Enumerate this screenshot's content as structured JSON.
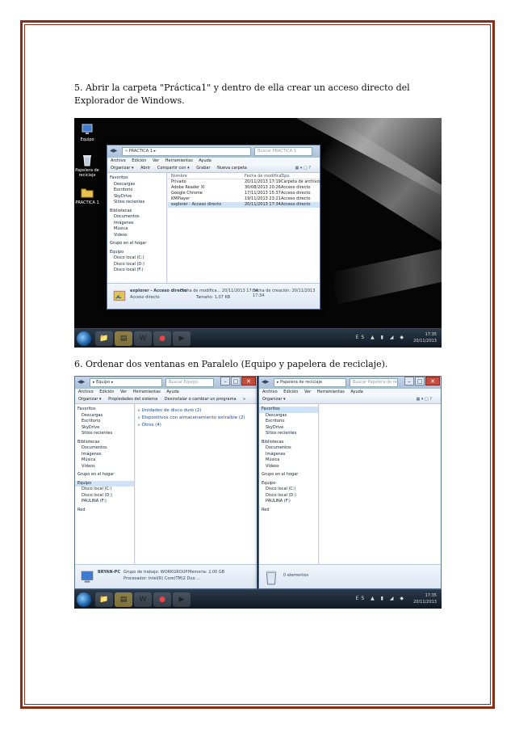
{
  "instructions": {
    "step5": "5. Abrir la carpeta \"Práctica1\" y dentro de ella crear un acceso directo del Explorador de Windows.",
    "step6": "6. Ordenar dos ventanas en Paralelo (Equipo y papelera de reciclaje)."
  },
  "shot1": {
    "desktop_icons": [
      {
        "label": "Equipo",
        "icon": "computer-icon"
      },
      {
        "label": "Papelera de reciclaje",
        "icon": "recycle-bin-icon"
      },
      {
        "label": "PRACTICA 1",
        "icon": "folder-icon"
      }
    ],
    "window": {
      "address": "« PRACTICA 1 ▸",
      "search_placeholder": "Buscar PRACTICA 1",
      "menu": [
        "Archivo",
        "Edición",
        "Ver",
        "Herramientas",
        "Ayuda"
      ],
      "toolbar": [
        "Organizar ▾",
        "Abrir",
        "Compartir con ▾",
        "Grabar",
        "Nueva carpeta"
      ],
      "nav": [
        {
          "label": "Favoritos",
          "header": true
        },
        {
          "label": "Descargas"
        },
        {
          "label": "Escritorio"
        },
        {
          "label": "SkyDrive"
        },
        {
          "label": "Sitios recientes"
        },
        {
          "label": "Bibliotecas",
          "header": true
        },
        {
          "label": "Documentos"
        },
        {
          "label": "Imágenes"
        },
        {
          "label": "Música"
        },
        {
          "label": "Videos"
        },
        {
          "label": "Grupo en el hogar",
          "header": true
        },
        {
          "label": "Equipo",
          "header": true
        },
        {
          "label": "Disco local (C:)"
        },
        {
          "label": "Disco local (D:)"
        },
        {
          "label": "Disco local (F:)"
        }
      ],
      "columns": [
        "Nombre",
        "Fecha de modifica...",
        "Tipo"
      ],
      "files": [
        {
          "name": "Privado",
          "date": "20/11/2013 17:19",
          "type": "Carpeta de archivos"
        },
        {
          "name": "Adobe Reader XI",
          "date": "30/08/2013 20:26",
          "type": "Acceso directo"
        },
        {
          "name": "Google Chrome",
          "date": "17/11/2013 15:37",
          "type": "Acceso directo"
        },
        {
          "name": "KMPlayer",
          "date": "19/11/2013 23:21",
          "type": "Acceso directo"
        },
        {
          "name": "explorer - Acceso directo",
          "date": "20/11/2013 17:34",
          "type": "Acceso directo",
          "selected": true
        }
      ],
      "details": {
        "name": "explorer - Acceso directo",
        "kind": "Acceso directo",
        "modified": "Fecha de modifica... 20/11/2013 17:34",
        "size": "Tamaño: 1,07 KB",
        "created": "Fecha de creación: 20/11/2013 17:34"
      }
    },
    "taskbar": {
      "lang": "ES",
      "time": "17:35",
      "date": "20/11/2013"
    }
  },
  "shot2": {
    "left_window": {
      "address": "▸ Equipo ▸",
      "search_placeholder": "Buscar Equipo",
      "menu": [
        "Archivo",
        "Edición",
        "Ver",
        "Herramientas",
        "Ayuda"
      ],
      "toolbar": [
        "Organizar ▾",
        "Propiedades del sistema",
        "Desinstalar o cambiar un programa",
        "»"
      ],
      "nav": [
        {
          "label": "Favoritos",
          "header": true
        },
        {
          "label": "Descargas"
        },
        {
          "label": "Escritorio"
        },
        {
          "label": "SkyDrive"
        },
        {
          "label": "Sitios recientes"
        },
        {
          "label": "Bibliotecas",
          "header": true
        },
        {
          "label": "Documentos"
        },
        {
          "label": "Imágenes"
        },
        {
          "label": "Música"
        },
        {
          "label": "Vídeos"
        },
        {
          "label": "Grupo en el hogar",
          "header": true
        },
        {
          "label": "Equipo",
          "header": true,
          "selected": true
        },
        {
          "label": "Disco local (C:)"
        },
        {
          "label": "Disco local (D:)"
        },
        {
          "label": "PAULINA (F:)"
        },
        {
          "label": "Red",
          "header": true
        }
      ],
      "groups": [
        "Unidades de disco duro (2)",
        "Dispositivos con almacenamiento extraíble (2)",
        "Otros (4)"
      ],
      "details": {
        "name": "BRYAN-PC",
        "workgroup": "Grupo de trabajo: WORKGROUP",
        "memory": "Memoria: 2,00 GB",
        "processor": "Procesador: Intel(R) Core(TM)2 Duo ..."
      }
    },
    "right_window": {
      "address": "▸ Papelera de reciclaje",
      "search_placeholder": "Buscar Papelera de reciclaje",
      "menu": [
        "Archivo",
        "Edición",
        "Ver",
        "Herramientas",
        "Ayuda"
      ],
      "toolbar": [
        "Organizar ▾"
      ],
      "nav": [
        {
          "label": "Favoritos",
          "header": true,
          "selected": true
        },
        {
          "label": "Descargas"
        },
        {
          "label": "Escritorio"
        },
        {
          "label": "SkyDrive"
        },
        {
          "label": "Sitios recientes"
        },
        {
          "label": "Bibliotecas",
          "header": true
        },
        {
          "label": "Documentos"
        },
        {
          "label": "Imágenes"
        },
        {
          "label": "Música"
        },
        {
          "label": "Vídeos"
        },
        {
          "label": "Grupo en el hogar",
          "header": true
        },
        {
          "label": "Equipo",
          "header": true
        },
        {
          "label": "Disco local (C:)"
        },
        {
          "label": "Disco local (D:)"
        },
        {
          "label": "PAULINA (F:)"
        },
        {
          "label": "Red",
          "header": true
        }
      ],
      "details": {
        "count": "0 elementos"
      }
    },
    "taskbar": {
      "lang": "ES",
      "time": "17:35",
      "date": "20/11/2013"
    }
  },
  "colors": {
    "border": "#8b2d12",
    "selection": "#cfe2f8",
    "taskbar": "#101822"
  }
}
